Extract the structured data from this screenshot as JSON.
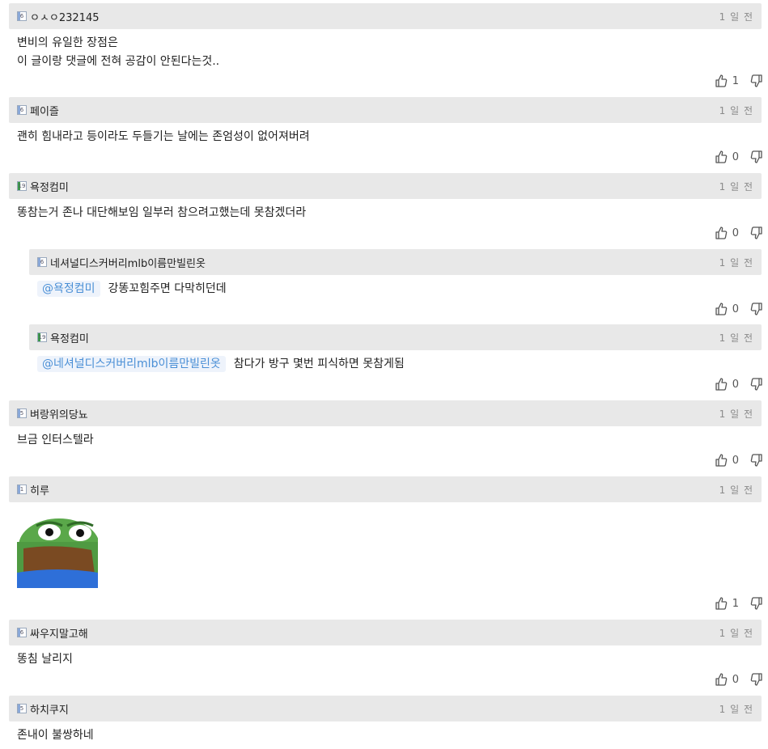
{
  "comments": [
    {
      "nick": "ㅇㅅㅇ232145",
      "level": "6",
      "time": "1 일 전",
      "lines": [
        "변비의 유일한 장점은",
        "이 글이랑 댓글에 전혀 공감이 안된다는것.."
      ],
      "likes": "1"
    },
    {
      "nick": "페이즐",
      "level": "6",
      "time": "1 일 전",
      "lines": [
        "괜히 힘내라고 등이라도 두들기는 날에는 존엄성이 없어져버려"
      ],
      "likes": "0"
    },
    {
      "nick": "욕정컴미",
      "level": "19",
      "time": "1 일 전",
      "lines": [
        "똥참는거 존나 대단해보임 일부러 참으려고했는데 못참겠더라"
      ],
      "likes": "0"
    },
    {
      "nick": "네셔널디스커버리mlb이름만빌린옷",
      "level": "6",
      "time": "1 일 전",
      "mention": "@욕정컴미",
      "text": "강똥꼬힘주면 다막히던데",
      "likes": "0"
    },
    {
      "nick": "욕정컴미",
      "level": "19",
      "time": "1 일 전",
      "mention": "@네셔널디스커버리mlb이름만빌린옷",
      "text": "참다가 방구 몇번 피식하면 못참게됨",
      "likes": "0"
    },
    {
      "nick": "벼랑위의당뇨",
      "level": "5",
      "time": "1 일 전",
      "lines": [
        "브금 인터스텔라"
      ],
      "likes": "0"
    },
    {
      "nick": "히루",
      "level": "1",
      "time": "1 일 전",
      "likes": "1"
    },
    {
      "nick": "싸우지말고해",
      "level": "6",
      "time": "1 일 전",
      "lines": [
        "똥침 날리지"
      ],
      "likes": "0"
    },
    {
      "nick": "하치쿠지",
      "level": "5",
      "time": "1 일 전",
      "lines": [
        "존내이 불쌍하네"
      ]
    }
  ]
}
